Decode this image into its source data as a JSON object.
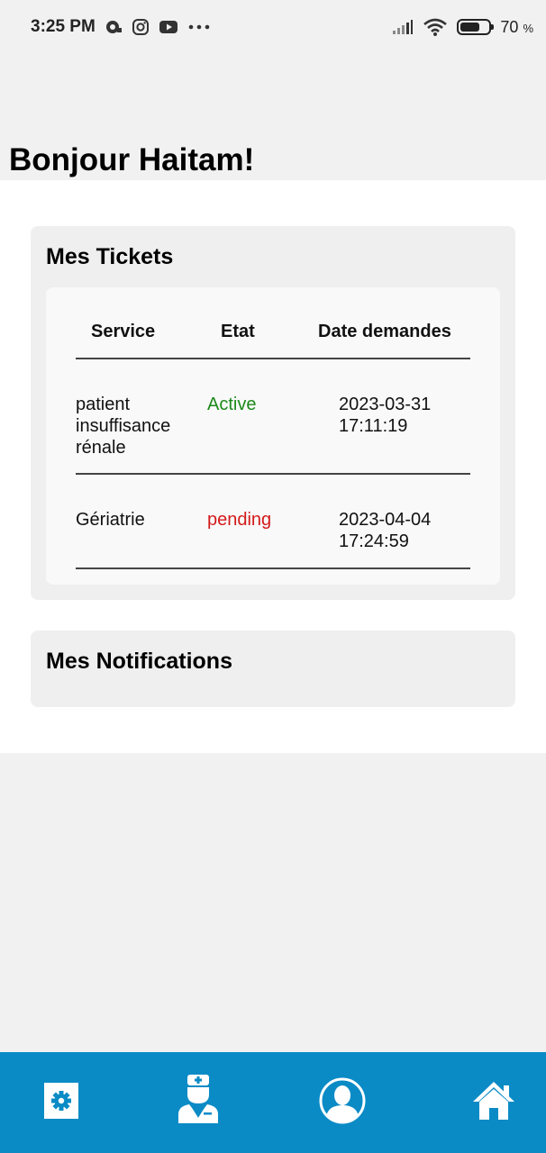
{
  "status_bar": {
    "time": "3:25 PM",
    "battery_percent": "70",
    "battery_unit": "%",
    "battery_level": 0.7,
    "icons": [
      "notification-icon",
      "instagram-icon",
      "youtube-icon",
      "more-dots-icon",
      "signal-icon",
      "wifi-icon",
      "battery-icon"
    ]
  },
  "greeting": "Bonjour Haitam!",
  "tickets": {
    "title": "Mes Tickets",
    "headers": [
      "Service",
      "Etat",
      "Date demandes"
    ],
    "rows": [
      {
        "service_lines": [
          "patient",
          "insuffisance",
          "rénale"
        ],
        "status": "Active",
        "date": "2023-03-31",
        "time": "17:11:19"
      },
      {
        "service_lines": [
          "Gériatrie"
        ],
        "status": "pending",
        "date": "2023-04-04",
        "time": "17:24:59"
      }
    ],
    "status_colors": {
      "Active": "#1b8a1b",
      "pending": "#d41a1a"
    }
  },
  "notifications": {
    "title": "Mes Notifications"
  },
  "bottom_nav": {
    "background": "#0a8bc6",
    "items": [
      "settings-icon",
      "doctor-icon",
      "profile-icon",
      "home-icon"
    ]
  }
}
